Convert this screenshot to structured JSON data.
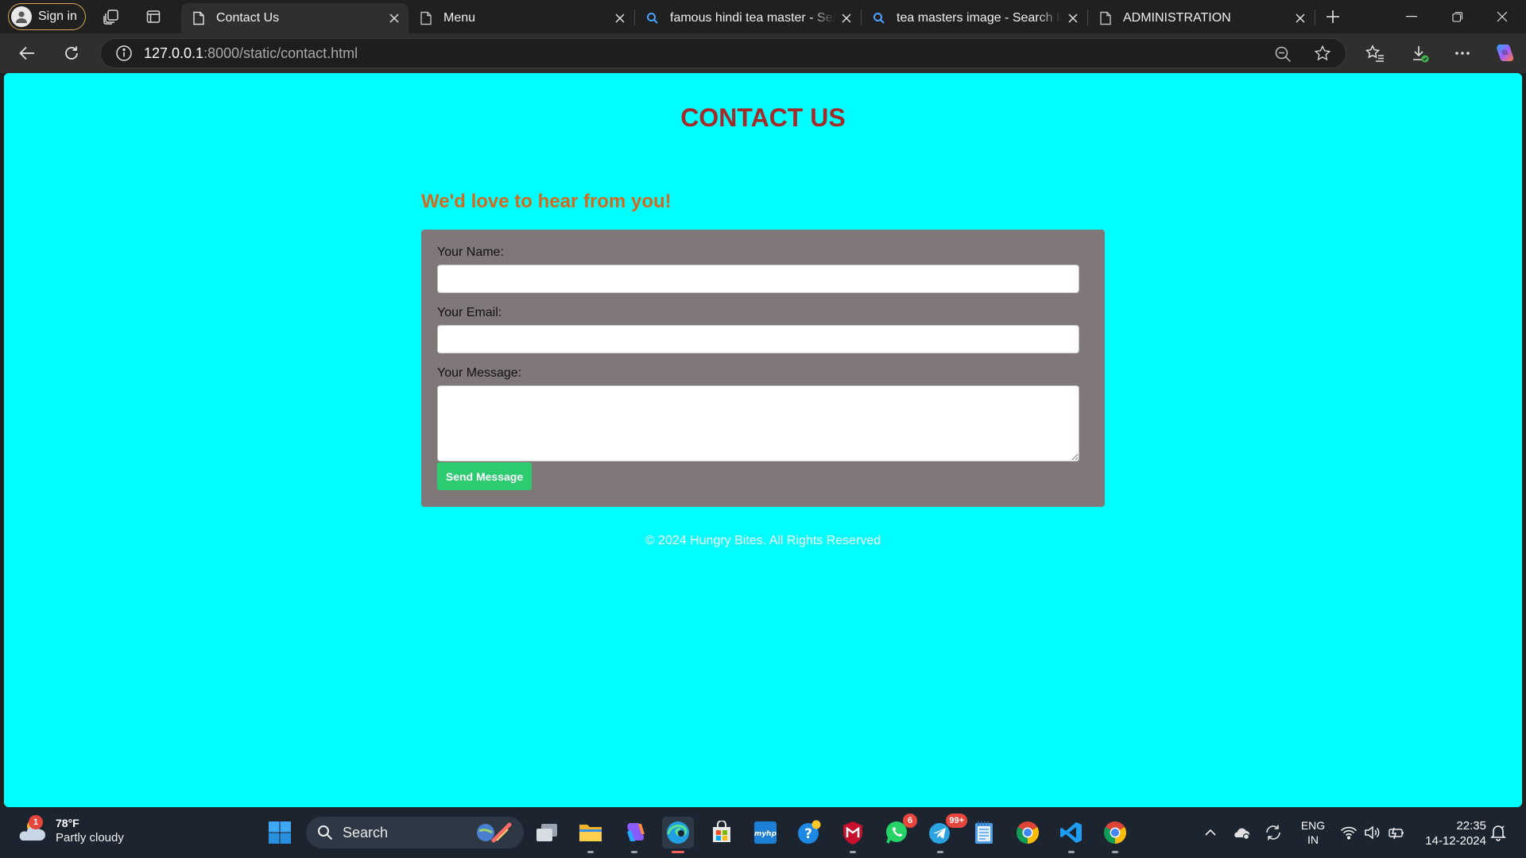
{
  "browser": {
    "profile_label": "Sign in",
    "tabs": [
      {
        "title": "Contact Us",
        "active": true,
        "icon": "page-icon"
      },
      {
        "title": "Menu",
        "active": false,
        "icon": "page-icon"
      },
      {
        "title": "famous hindi tea master - Search",
        "active": false,
        "icon": "search-icon"
      },
      {
        "title": "tea masters image - Search Images",
        "active": false,
        "icon": "search-icon"
      },
      {
        "title": "ADMINISTRATION",
        "active": false,
        "icon": "page-icon"
      }
    ],
    "url_host": "127.0.0.1",
    "url_path": ":8000/static/contact.html"
  },
  "page": {
    "title": "CONTACT US",
    "subheading": "We'd love to hear from you!",
    "form": {
      "name_label": "Your Name:",
      "name_value": "",
      "email_label": "Your Email:",
      "email_value": "",
      "message_label": "Your Message:",
      "message_value": "",
      "submit_label": "Send Message"
    },
    "footer": "© 2024 Hungry Bites. All Rights Reserved",
    "colors": {
      "background": "#00ffff",
      "title": "#a52a2a",
      "subheading": "#d2691e",
      "form_background": "#807878",
      "button": "#2ecc71"
    }
  },
  "taskbar": {
    "weather": {
      "badge": "1",
      "temp": "78°F",
      "condition": "Partly cloudy"
    },
    "search_label": "Search",
    "badges": {
      "whatsapp": "6",
      "telegram": "99+"
    },
    "language": {
      "line1": "ENG",
      "line2": "IN"
    },
    "clock": {
      "time": "22:35",
      "date": "14-12-2024"
    }
  }
}
